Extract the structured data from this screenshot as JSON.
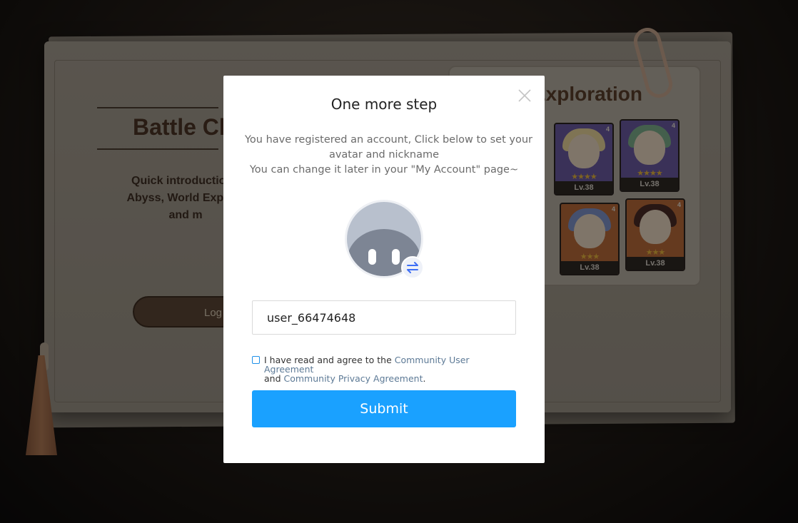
{
  "background": {
    "title": "Battle Ch",
    "intro_lines": [
      "Quick introduction t",
      "Abyss, World Explora",
      "and m"
    ],
    "login_label": "Log",
    "exploration_title": "Exploration",
    "cards": [
      {
        "level": "Lv.38",
        "stars": "★★★★",
        "rank": "4",
        "hair_color": "#e7d39a"
      },
      {
        "level": "Lv.38",
        "stars": "★★★★",
        "rank": "4",
        "hair_color": "#7dae8a"
      },
      {
        "level": "Lv.38",
        "stars": "★★★",
        "rank": "4",
        "hair_color": "#7f93c8"
      },
      {
        "level": "Lv.38",
        "stars": "★★★",
        "rank": "4",
        "hair_color": "#4a2a26"
      }
    ]
  },
  "modal": {
    "title": "One more step",
    "description_lines": [
      "You have registered an account, Click below to set your",
      "avatar and nickname",
      "You can change it later in your \"My Account\" page~"
    ],
    "avatar_icon": "default-avatar-icon",
    "swap_icon": "swap-arrows-icon",
    "close_icon": "close-icon",
    "nickname_value": "user_66474648",
    "agreement": {
      "prefix": "I have read and agree to the ",
      "link1": "Community User Agreement",
      "middle": "and ",
      "link2": "Community Privacy Agreement",
      "suffix": "."
    },
    "submit_label": "Submit"
  },
  "colors": {
    "primary_button": "#1aa1ff",
    "link": "#5d7a96",
    "swap_icon": "#3d6ef5"
  }
}
